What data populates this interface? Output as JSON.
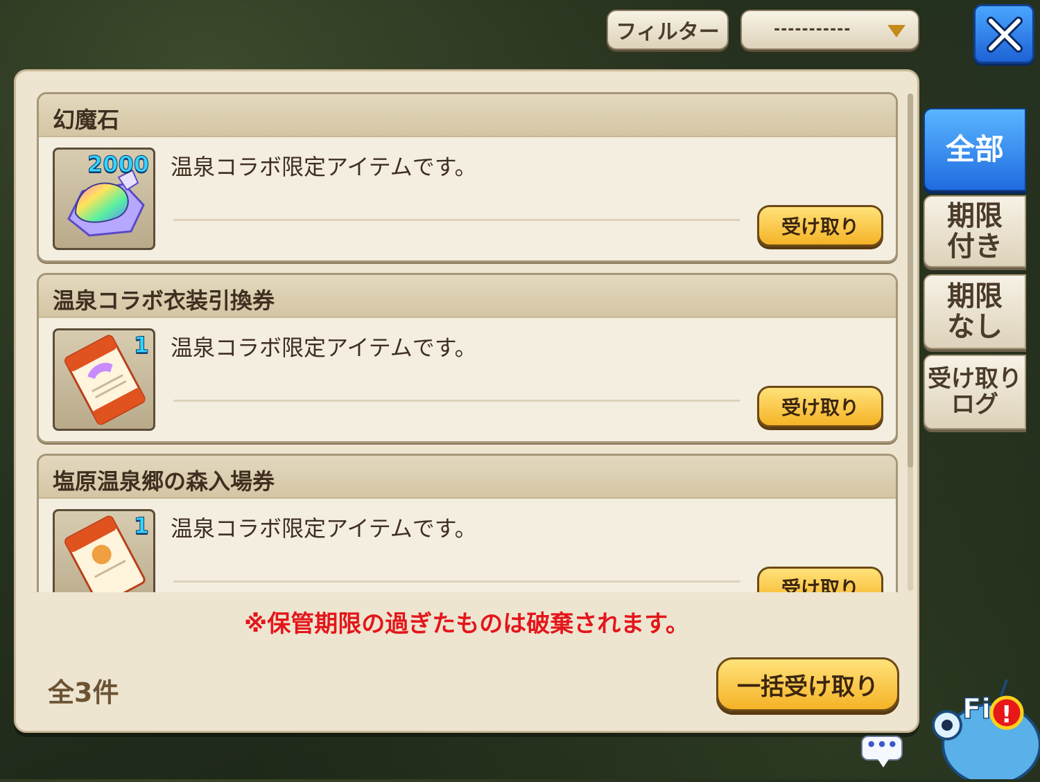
{
  "top_bar": {
    "filter_label": "フィルター",
    "filter_value": "-----------"
  },
  "tabs": [
    {
      "label": "全部"
    },
    {
      "label": "期限\n付き"
    },
    {
      "label": "期限\nなし"
    },
    {
      "label": "受け取り\nログ"
    }
  ],
  "items": [
    {
      "name": "幻魔石",
      "quantity": "2000",
      "description": "温泉コラボ限定アイテムです。",
      "claim_label": "受け取り"
    },
    {
      "name": "温泉コラボ衣装引換券",
      "quantity": "1",
      "description": "温泉コラボ限定アイテムです。",
      "claim_label": "受け取り"
    },
    {
      "name": "塩原温泉郷の森入場券",
      "quantity": "1",
      "description": "温泉コラボ限定アイテムです。",
      "claim_label": "受け取り"
    }
  ],
  "notice": "※保管期限の過ぎたものは破棄されます。",
  "total": "全3件",
  "bulk_claim_label": "一括受け取り",
  "chat_bubble": "•••",
  "mascot": {
    "text": "Fi",
    "badge": "!"
  },
  "colors": {
    "accent_blue": "#1f6be0",
    "claim_gold": "#f5b326",
    "notice_red": "#e3161b"
  }
}
